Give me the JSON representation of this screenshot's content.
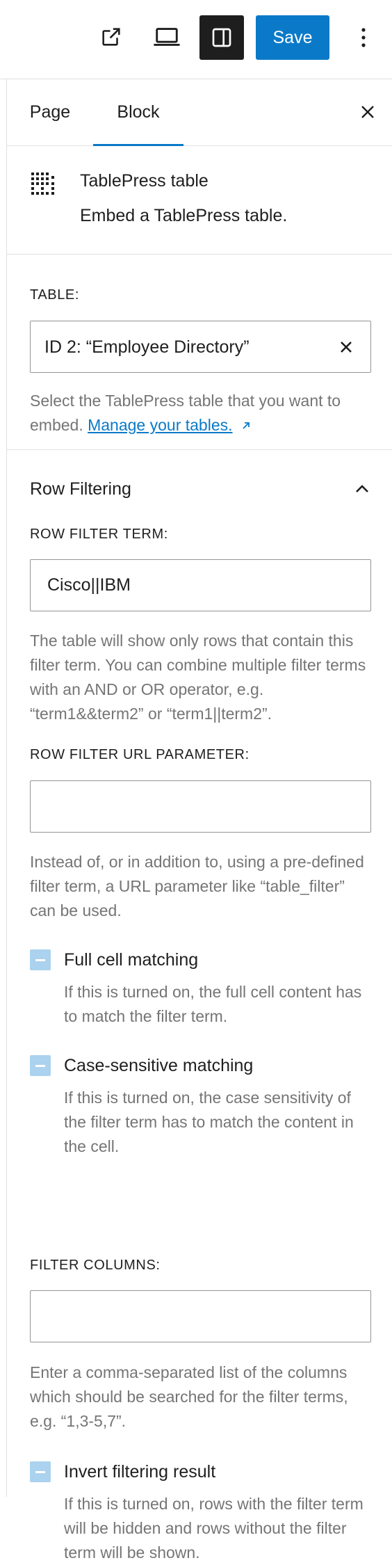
{
  "toolbar": {
    "external_icon": "external-link-icon",
    "view_icon": "laptop-icon",
    "settings_icon": "sidebar-settings-icon",
    "save_label": "Save",
    "more_icon": "vertical-ellipsis-icon",
    "accent_color": "#0a7ac8"
  },
  "tabs": {
    "items": [
      {
        "label": "Page"
      },
      {
        "label": "Block",
        "active": true
      }
    ],
    "close_icon": "close-icon"
  },
  "block": {
    "icon": "table-grid-icon",
    "title": "TablePress table",
    "description": "Embed a TablePress table."
  },
  "table_section": {
    "label": "TABLE:",
    "value": "ID 2: “Employee Directory”",
    "clear_icon": "clear-icon",
    "help_prefix": "Select the TablePress table that you want to embed.",
    "help_link": "Manage your tables.",
    "link_icon": "arrow-up-right-icon"
  },
  "row_filtering": {
    "title": "Row Filtering",
    "expanded": true,
    "toggle_icon": "chevron-up-icon",
    "filter_term": {
      "label": "ROW FILTER TERM:",
      "value": "Cisco||IBM",
      "help": "The table will show only rows that contain this filter term. You can combine multiple filter terms with an AND or OR operator, e.g. “term1&&term2” or “term1||term2”."
    },
    "url_param": {
      "label": "ROW FILTER URL PARAMETER:",
      "value": "",
      "help": "Instead of, or in addition to, using a pre-defined filter term, a URL parameter like “table_filter” can be used."
    },
    "full_cell": {
      "label": "Full cell matching",
      "state": "indeterminate",
      "help": "If this is turned on, the full cell content has to match the filter term."
    },
    "case_sensitive": {
      "label": "Case-sensitive matching",
      "state": "indeterminate",
      "help": "If this is turned on, the case sensitivity of the filter term has to match the content in the cell."
    },
    "filter_columns": {
      "label": "FILTER COLUMNS:",
      "value": "",
      "help": "Enter a comma-separated list of the columns which should be searched for the filter terms, e.g. “1,3-5,7”."
    },
    "invert": {
      "label": "Invert filtering result",
      "state": "indeterminate",
      "help": "If this is turned on, rows with the filter term will be hidden and rows without the filter term will be shown."
    }
  }
}
